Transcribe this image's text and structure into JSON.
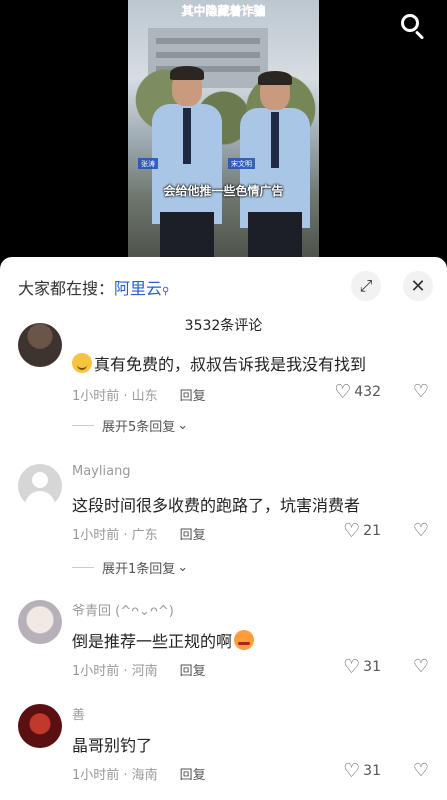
{
  "video": {
    "title": "其中隐藏着诈骗",
    "subtitle": "会给他推一些色情广告",
    "name_tag_left": "张涛",
    "name_tag_right": "宋文明"
  },
  "panel": {
    "search_prefix": "大家都在搜：",
    "search_keyword": "阿里云",
    "comment_count": "3532条评论",
    "expand_icon": "expand-icon",
    "close_icon": "close-icon"
  },
  "comments": [
    {
      "user": "",
      "text": "真有免费的，叔叔告诉我是我没有找到",
      "time_loc": "1小时前 · 山东",
      "reply_label": "回复",
      "likes": "432",
      "expand": "展开5条回复"
    },
    {
      "user": "Mayliang",
      "text": "这段时间很多收费的跑路了，坑害消费者",
      "time_loc": "1小时前 · 广东",
      "reply_label": "回复",
      "likes": "21",
      "expand": "展开1条回复"
    },
    {
      "user": "爷青回 (^ᴖ⌄ᴖ^)",
      "text": "倒是推荐一些正规的啊",
      "time_loc": "1小时前 · 河南",
      "reply_label": "回复",
      "likes": "31"
    },
    {
      "user": "善",
      "text": "晶哥别钓了",
      "time_loc": "1小时前 · 海南",
      "reply_label": "回复",
      "likes": "31"
    }
  ],
  "colors": {
    "link_blue": "#2a5fc7",
    "muted_text": "#9a9a9a",
    "title_red": "#ff3b30"
  }
}
